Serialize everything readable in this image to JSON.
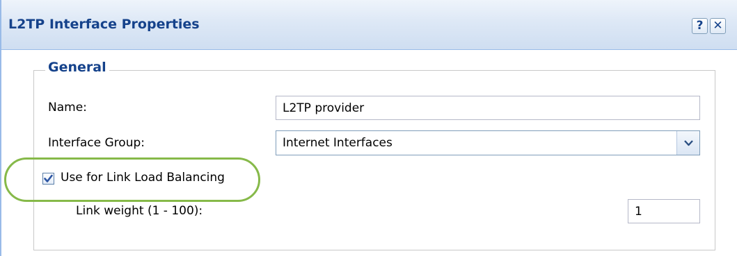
{
  "dialog": {
    "title": "L2TP Interface Properties",
    "help_label": "?",
    "close_label": "✕"
  },
  "general": {
    "legend": "General",
    "name_label": "Name:",
    "name_value": "L2TP provider",
    "group_label": "Interface Group:",
    "group_value": "Internet Interfaces",
    "lb_checked": true,
    "lb_label": "Use for Link Load Balancing",
    "weight_label": "Link weight (1 - 100):",
    "weight_value": "1"
  },
  "icons": {
    "help": "help-icon",
    "close": "close-icon",
    "dropdown": "chevron-down-icon",
    "checkmark": "checkmark-icon"
  },
  "colors": {
    "title_text": "#15428b",
    "titlebar_bg": "#dde8f6",
    "border": "#99bbe8",
    "highlight": "#86b949"
  }
}
